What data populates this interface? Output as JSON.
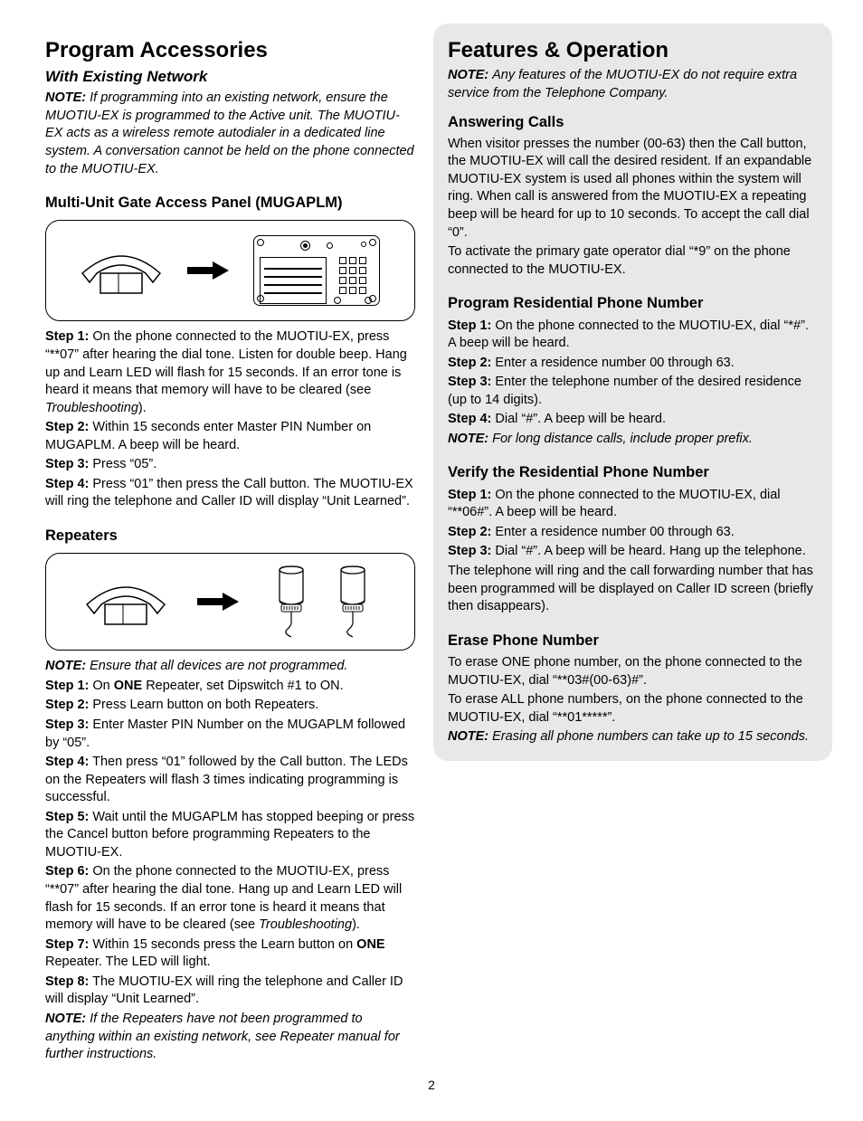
{
  "page_number": "2",
  "left": {
    "heading": "Program Accessories",
    "subheading": "With Existing Network",
    "intro_note": "If programming into an existing network, ensure the MUOTIU-EX is programmed to the Active unit. The MUOTIU-EX acts as a wireless remote autodialer in a dedicated line system. A conversation cannot be held on the phone connected to the MUOTIU-EX.",
    "mugaplm": {
      "title": "Multi-Unit Gate Access Panel (MUGAPLM)",
      "step1": "On the phone connected to the MUOTIU-EX, press “**07” after hearing the dial tone. Listen for double beep. Hang up and Learn LED will flash for 15 seconds. If an error tone is heard it means that memory will have to be cleared (see ",
      "step1_tail": ").",
      "step2": "Within 15 seconds enter Master PIN Number on MUGAPLM. A beep will be heard.",
      "step3": "Press “05”.",
      "step4": "Press “01” then press the Call button. The MUOTIU-EX will ring the telephone and Caller ID will display “Unit Learned”.",
      "trouble": "Troubleshooting"
    },
    "repeaters": {
      "title": "Repeaters",
      "note1": "Ensure that all devices are not programmed.",
      "step1_pre": "On ",
      "step1_bold": "ONE",
      "step1_post": " Repeater, set Dipswitch #1 to ON.",
      "step2": "Press Learn button on both Repeaters.",
      "step3": "Enter Master PIN Number on the MUGAPLM followed by “05”.",
      "step4": "Then press “01” followed by the Call button. The LEDs on the Repeaters will flash 3 times indicating programming is successful.",
      "step5": "Wait until the MUGAPLM has stopped beeping or press the Cancel button before programming Repeaters to the MUOTIU-EX.",
      "step6": "On the phone connected to the MUOTIU-EX, press “**07” after hearing the dial tone. Hang up and Learn LED will flash for 15 seconds. If an error tone is heard it means that memory will have to be cleared (see ",
      "step6_tail": ").",
      "step7_pre": "Within 15 seconds press the Learn button on ",
      "step7_bold": "ONE",
      "step7_post": " Repeater. The LED will light.",
      "step8": "The MUOTIU-EX will ring the telephone and Caller ID will display “Unit Learned”.",
      "note2": "If the Repeaters have not been programmed to anything within an existing network, see Repeater manual for further instructions.",
      "trouble": "Troubleshooting"
    },
    "labels": {
      "note": "NOTE:",
      "step1": "Step 1:",
      "step2": "Step 2:",
      "step3": "Step 3:",
      "step4": "Step 4:",
      "step5": "Step 5:",
      "step6": "Step 6:",
      "step7": "Step 7:",
      "step8": "Step 8:"
    }
  },
  "right": {
    "heading": "Features & Operation",
    "intro_note": "Any features of the MUOTIU-EX do not require extra service from the Telephone Company.",
    "answering": {
      "title": "Answering Calls",
      "p1": "When visitor presses the number (00-63) then the Call button, the MUOTIU-EX will call the desired resident. If an expandable MUOTIU-EX system is used all phones within the system will ring. When call is answered from the MUOTIU-EX a repeating beep will be heard for up to 10 seconds. To accept the call dial “0”.",
      "p2": "To activate the primary gate operator dial “*9” on the phone connected to the MUOTIU-EX."
    },
    "program": {
      "title": "Program Residential Phone Number",
      "step1": "On the phone connected to the MUOTIU-EX, dial “*#”. A beep will be heard.",
      "step2": "Enter a residence number 00 through 63.",
      "step3": "Enter the telephone number of the desired residence (up to 14 digits).",
      "step4": "Dial “#”. A beep will be heard.",
      "note": "For long distance calls, include proper prefix."
    },
    "verify": {
      "title": "Verify the Residential Phone Number",
      "step1": "On the phone connected to the MUOTIU-EX, dial “**06#”. A beep will be heard.",
      "step2": "Enter a residence number 00 through 63.",
      "step3": "Dial “#”. A beep will be heard. Hang up the telephone.",
      "p1": "The telephone will ring and the call forwarding number that has been programmed will be displayed on Caller ID screen (briefly then disappears)."
    },
    "erase": {
      "title": "Erase Phone Number",
      "p1": "To erase ONE phone number, on the phone connected to the MUOTIU-EX, dial “**03#(00-63)#”.",
      "p2": "To erase ALL phone numbers, on the phone connected to the MUOTIU-EX, dial “**01*****”.",
      "note": "Erasing all phone numbers can take up to 15 seconds."
    }
  }
}
